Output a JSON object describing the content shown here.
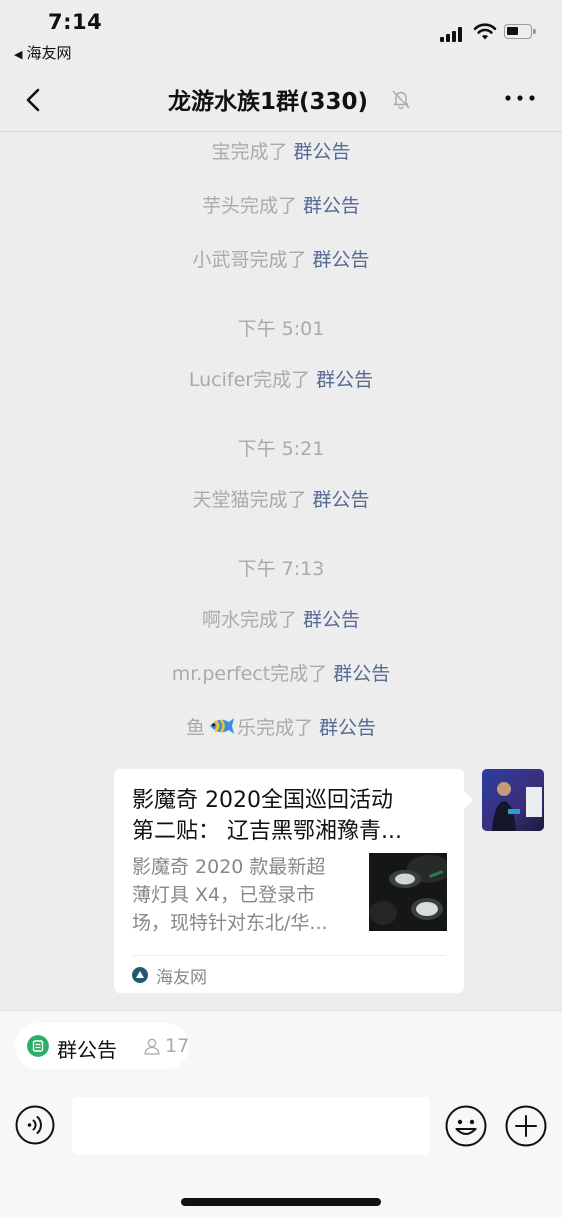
{
  "status_bar": {
    "time": "7:14",
    "back_app": "海友网"
  },
  "nav": {
    "title": "龙游水族1群(330)",
    "icons": [
      "back-chevron-icon",
      "mute-bell-icon",
      "more-dots-icon"
    ]
  },
  "system_messages": [
    {
      "actor": "宝完成了",
      "link": "群公告"
    },
    {
      "actor": "芋头完成了",
      "link": "群公告"
    },
    {
      "actor": "小武哥完成了",
      "link": "群公告"
    },
    {
      "timestamp": "下午 5:01"
    },
    {
      "actor": "Lucifer完成了",
      "link": "群公告"
    },
    {
      "timestamp": "下午 5:21"
    },
    {
      "actor": "天堂猫完成了",
      "link": "群公告"
    },
    {
      "timestamp": "下午 7:13"
    },
    {
      "actor": "啊水完成了",
      "link": "群公告"
    },
    {
      "actor": "mr.perfect完成了",
      "link": "群公告"
    },
    {
      "actor_prefix": "鱼",
      "actor_suffix": "乐完成了",
      "link": "群公告"
    }
  ],
  "card": {
    "title_line1": "影魔奇 2020全国巡回活动",
    "title_line2": "第二贴： 辽吉黑鄂湘豫青...",
    "desc_line1": "影魔奇 2020 款最新超",
    "desc_line2": "薄灯具 X4，已登录市",
    "desc_line3": "场，现特针对东北/华...",
    "source": "海友网"
  },
  "bottom": {
    "chip_label": "群公告",
    "chip_count": "17",
    "input_placeholder": ""
  },
  "colors": {
    "link": "#576B95",
    "system_text": "#AAAAAA",
    "chat_bg": "#EDEDED",
    "chip_green": "#2BAE66"
  }
}
